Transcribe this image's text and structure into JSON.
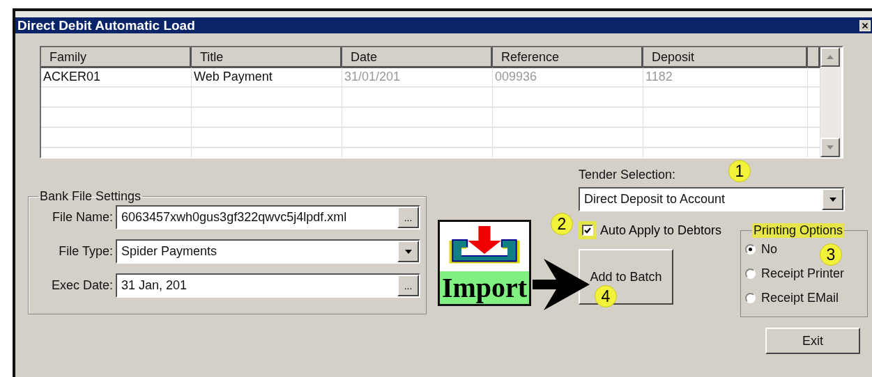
{
  "window": {
    "title": "Direct Debit Automatic Load"
  },
  "table": {
    "columns": [
      "Family",
      "Title",
      "Date",
      "Reference",
      "Deposit"
    ],
    "rows": [
      {
        "cells": [
          {
            "text": "ACKER01",
            "disabled": false
          },
          {
            "text": "Web Payment",
            "disabled": false
          },
          {
            "text": "31/01/201",
            "disabled": true
          },
          {
            "text": "009936",
            "disabled": true
          },
          {
            "text": "1182",
            "disabled": true
          }
        ]
      }
    ]
  },
  "bank_file_settings": {
    "title": "Bank File Settings",
    "fields": [
      {
        "label": "File Name:",
        "value": "6063457xwh0gus3gf322qwvc5j4lpdf.xml",
        "kind": "browse",
        "button": "..."
      },
      {
        "label": "File Type:",
        "value": "Spider Payments",
        "kind": "dropdown"
      },
      {
        "label": "Exec Date:",
        "value": "31 Jan, 201",
        "kind": "browse",
        "button": "..."
      }
    ]
  },
  "import_button": {
    "label": "Import"
  },
  "tender_selection": {
    "label": "Tender Selection:",
    "value": "Direct Deposit to Account"
  },
  "auto_apply": {
    "label": "Auto Apply to Debtors",
    "checked": true,
    "highlighted": true
  },
  "add_to_batch_button": {
    "label": "Add to Batch"
  },
  "printing_options": {
    "title": "Printing Options",
    "highlighted": true,
    "options": [
      {
        "label": "No",
        "selected": true
      },
      {
        "label": "Receipt Printer",
        "selected": false
      },
      {
        "label": "Receipt EMail",
        "selected": false
      }
    ]
  },
  "exit_button": {
    "label": "Exit"
  },
  "callouts": [
    "1",
    "2",
    "3",
    "4"
  ]
}
